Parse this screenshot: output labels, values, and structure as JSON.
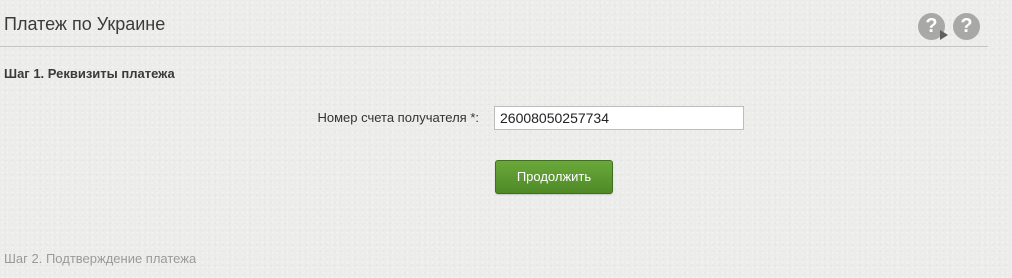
{
  "header": {
    "title": "Платеж по Украине",
    "help_icon_1": "?",
    "help_icon_2": "?"
  },
  "step1": {
    "title": "Шаг 1. Реквизиты платежа",
    "account_label": "Номер счета получателя *:",
    "account_value": "26008050257734",
    "continue_label": "Продолжить"
  },
  "step2": {
    "title": "Шаг 2. Подтверждение платежа"
  },
  "colors": {
    "accent_green": "#5a9630",
    "background": "#ececeb"
  },
  "icons": {
    "video_help": "video-help-icon",
    "help": "help-icon"
  }
}
